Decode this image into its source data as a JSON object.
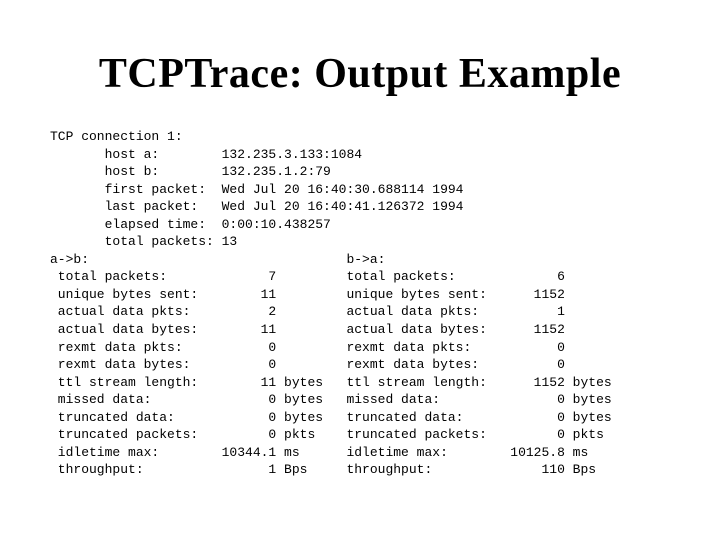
{
  "title": "TCPTrace: Output Example",
  "conn": {
    "header": "TCP connection 1:",
    "host_a_label": "host a:",
    "host_a_value": "132.235.3.133:1084",
    "host_b_label": "host b:",
    "host_b_value": "132.235.1.2:79",
    "first_packet_label": "first packet:",
    "first_packet_value": "Wed Jul 20 16:40:30.688114 1994",
    "last_packet_label": "last packet:",
    "last_packet_value": "Wed Jul 20 16:40:41.126372 1994",
    "elapsed_label": "elapsed time:",
    "elapsed_value": "0:00:10.438257",
    "total_packets_label": "total packets:",
    "total_packets_value": "13"
  },
  "dir": {
    "ab_label": "a->b:",
    "ba_label": "b->a:"
  },
  "rows": {
    "total_packets": {
      "label": "total packets:",
      "a": "7",
      "a_unit": "",
      "b": "6",
      "b_unit": ""
    },
    "unique_bytes_sent": {
      "label": "unique bytes sent:",
      "a": "11",
      "a_unit": "",
      "b": "1152",
      "b_unit": ""
    },
    "actual_data_pkts": {
      "label": "actual data pkts:",
      "a": "2",
      "a_unit": "",
      "b": "1",
      "b_unit": ""
    },
    "actual_data_bytes": {
      "label": "actual data bytes:",
      "a": "11",
      "a_unit": "",
      "b": "1152",
      "b_unit": ""
    },
    "rexmt_data_pkts": {
      "label": "rexmt data pkts:",
      "a": "0",
      "a_unit": "",
      "b": "0",
      "b_unit": ""
    },
    "rexmt_data_bytes": {
      "label": "rexmt data bytes:",
      "a": "0",
      "a_unit": "",
      "b": "0",
      "b_unit": ""
    },
    "ttl_stream_length": {
      "label": "ttl stream length:",
      "a": "11",
      "a_unit": "bytes",
      "b": "1152",
      "b_unit": "bytes"
    },
    "missed_data": {
      "label": "missed data:",
      "a": "0",
      "a_unit": "bytes",
      "b": "0",
      "b_unit": "bytes"
    },
    "truncated_data": {
      "label": "truncated data:",
      "a": "0",
      "a_unit": "bytes",
      "b": "0",
      "b_unit": "bytes"
    },
    "truncated_packets": {
      "label": "truncated packets:",
      "a": "0",
      "a_unit": "pkts",
      "b": "0",
      "b_unit": "pkts"
    },
    "idletime_max": {
      "label": "idletime max:",
      "a": "10344.1",
      "a_unit": "ms",
      "b": "10125.8",
      "b_unit": "ms"
    },
    "throughput": {
      "label": "throughput:",
      "a": "1",
      "a_unit": "Bps",
      "b": "110",
      "b_unit": "Bps"
    }
  }
}
